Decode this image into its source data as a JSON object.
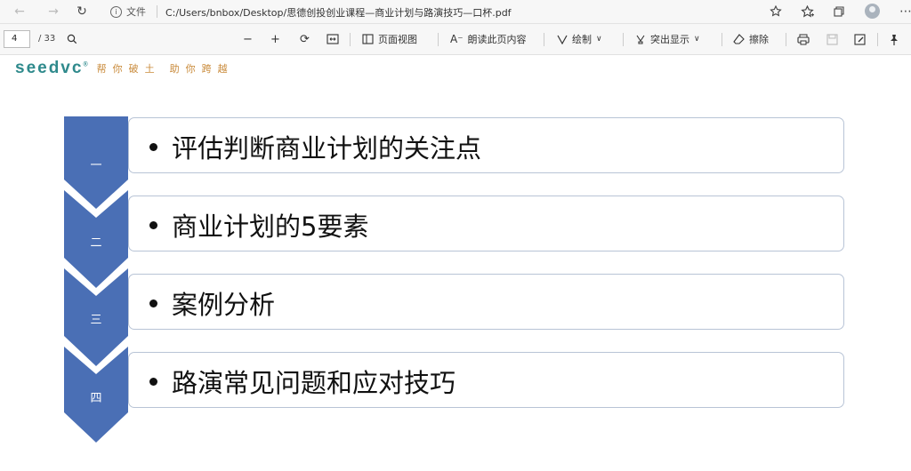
{
  "browser": {
    "address_label": "文件",
    "url": "C:/Users/bnbox/Desktop/思德创投创业课程—商业计划与路演技巧—口杯.pdf"
  },
  "pdf_toolbar": {
    "page_current": "4",
    "page_total": "/ 33",
    "page_view_label": "页面视图",
    "read_aloud_label": "朗读此页内容",
    "draw_label": "绘制",
    "highlight_label": "突出显示",
    "erase_label": "擦除"
  },
  "slide": {
    "logo_text": "seedvc",
    "logo_mark": "®",
    "slogan_left": "帮你破土",
    "slogan_right": "助你跨越",
    "items": [
      {
        "num": "一",
        "text": "评估判断商业计划的关注点"
      },
      {
        "num": "二",
        "text": "商业计划的5要素"
      },
      {
        "num": "三",
        "text": "案例分析"
      },
      {
        "num": "四",
        "text": "路演常见问题和应对技巧"
      }
    ]
  },
  "colors": {
    "chevron_blue": "#4a6fb5",
    "logo_teal": "#2f8a8c",
    "slogan_orange": "#c98a3a",
    "box_border": "#b8c4d6"
  }
}
